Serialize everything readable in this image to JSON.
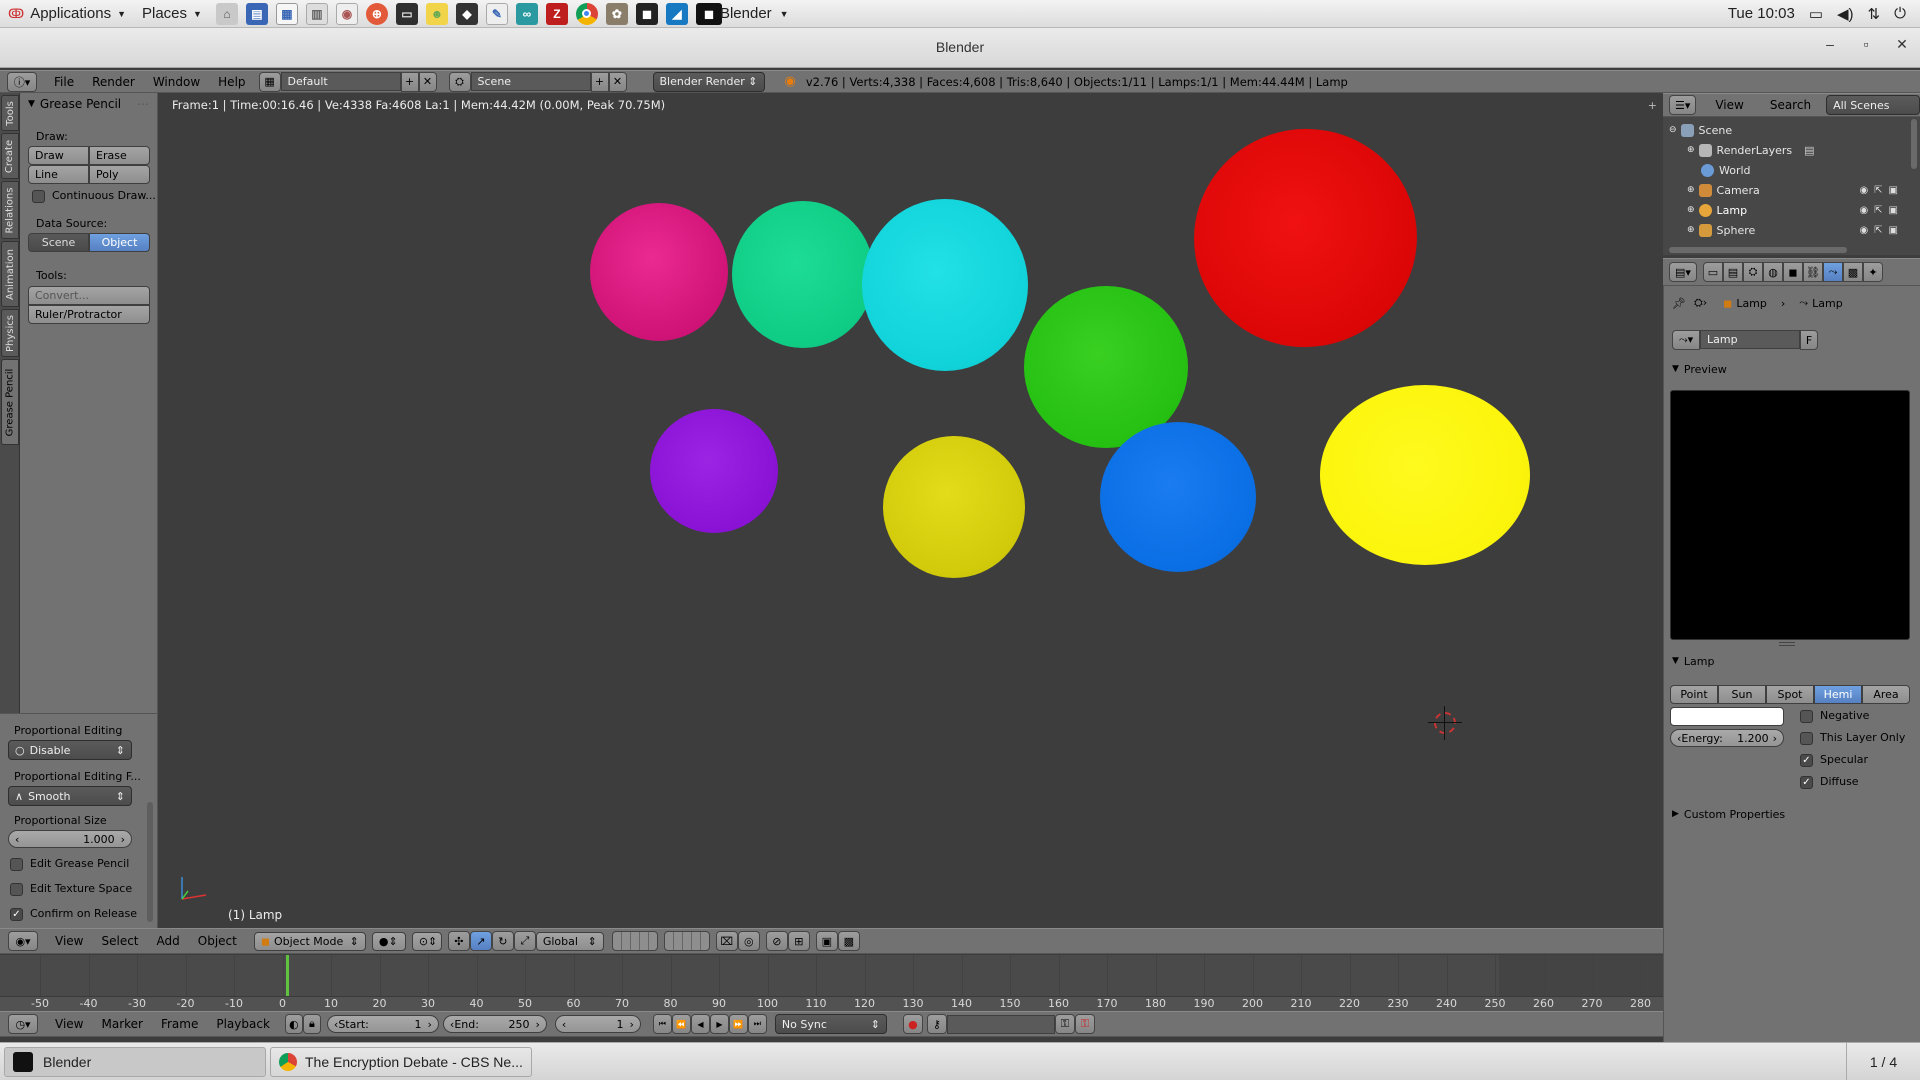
{
  "top_panel": {
    "applications": "Applications",
    "places": "Places",
    "clock": "Tue 10:03",
    "launchers": [
      "home-folder-icon",
      "network-icon",
      "text-editor-icon",
      "files-icon",
      "photo-icon",
      "help-icon",
      "terminal-icon",
      "pidgin-icon",
      "inkscape-icon",
      "editor-icon",
      "arduino-icon",
      "filezilla-icon",
      "chrome-icon",
      "gimp-icon",
      "cube-icon",
      "wireshark-icon"
    ],
    "active_app": "Blender"
  },
  "window": {
    "title": "Blender"
  },
  "info_header": {
    "menus": [
      "File",
      "Render",
      "Window",
      "Help"
    ],
    "layout": "Default",
    "scene": "Scene",
    "engine": "Blender Render",
    "stats": "v2.76 | Verts:4,338 | Faces:4,608 | Tris:8,640 | Objects:1/11 | Lamps:1/1 | Mem:44.44M | Lamp"
  },
  "tool_shelf": {
    "tabs": [
      "Tools",
      "Create",
      "Relations",
      "Animation",
      "Physics",
      "Grease Pencil"
    ],
    "panel_title": "Grease Pencil",
    "draw_label": "Draw:",
    "draw": "Draw",
    "erase": "Erase",
    "line": "Line",
    "poly": "Poly",
    "continuous": "Continuous Draw...",
    "data_source_label": "Data Source:",
    "scene": "Scene",
    "object": "Object",
    "tools_label": "Tools:",
    "convert": "Convert...",
    "ruler": "Ruler/Protractor"
  },
  "operator_panel": {
    "prop_editing_label": "Proportional Editing",
    "prop_editing_value": "Disable",
    "falloff_label": "Proportional Editing F...",
    "falloff_value": "Smooth",
    "size_label": "Proportional Size",
    "size_value": "1.000",
    "edit_gp": "Edit Grease Pencil",
    "edit_texture": "Edit Texture Space",
    "confirm": "Confirm on Release"
  },
  "viewport": {
    "info": "Frame:1 | Time:00:16.46 | Ve:4338 Fa:4608 La:1 | Mem:44.42M (0.00M, Peak 70.75M)",
    "object_label": "(1) Lamp",
    "spheres": [
      {
        "name": "magenta-sphere",
        "color": "#e0157f"
      },
      {
        "name": "teal-sphere",
        "color": "#10d38a"
      },
      {
        "name": "cyan-sphere",
        "color": "#10d6dc"
      },
      {
        "name": "green-sphere",
        "color": "#27c412"
      },
      {
        "name": "red-sphere",
        "color": "#e00808"
      },
      {
        "name": "purple-sphere",
        "color": "#8c13d8"
      },
      {
        "name": "olive-yellow-sphere",
        "color": "#d6cf0a"
      },
      {
        "name": "blue-sphere",
        "color": "#0a6fe6"
      },
      {
        "name": "yellow-sphere",
        "color": "#fbf40c"
      }
    ]
  },
  "view3d_header": {
    "menus": [
      "View",
      "Select",
      "Add",
      "Object"
    ],
    "mode": "Object Mode",
    "orientation": "Global"
  },
  "timeline": {
    "ticks": [
      "-50",
      "-40",
      "-30",
      "-20",
      "-10",
      "0",
      "10",
      "20",
      "30",
      "40",
      "50",
      "60",
      "70",
      "80",
      "90",
      "100",
      "110",
      "120",
      "130",
      "140",
      "150",
      "160",
      "170",
      "180",
      "190",
      "200",
      "210",
      "220",
      "230",
      "240",
      "250",
      "260",
      "270",
      "280"
    ],
    "menus": [
      "View",
      "Marker",
      "Frame",
      "Playback"
    ],
    "start_label": "Start:",
    "start": "1",
    "end_label": "End:",
    "end": "250",
    "current": "1",
    "sync": "No Sync"
  },
  "outliner": {
    "menus": [
      "View",
      "Search"
    ],
    "filter": "All Scenes",
    "rows": [
      "Scene",
      "RenderLayers",
      "World",
      "Camera",
      "Lamp",
      "Sphere"
    ]
  },
  "properties": {
    "breadcrumb_1": "Lamp",
    "breadcrumb_2": "Lamp",
    "datablock": "Lamp",
    "fake_user": "F",
    "preview_title": "Preview",
    "lamp_title": "Lamp",
    "types": [
      "Point",
      "Sun",
      "Spot",
      "Hemi",
      "Area"
    ],
    "energy_label": "Energy:",
    "energy": "1.200",
    "negative": "Negative",
    "this_layer_only": "This Layer Only",
    "specular": "Specular",
    "diffuse": "Diffuse",
    "custom_props": "Custom Properties"
  },
  "taskbar": {
    "task1": "Blender",
    "task2": "The Encryption Debate - CBS Ne...",
    "workspace": "1 / 4"
  }
}
